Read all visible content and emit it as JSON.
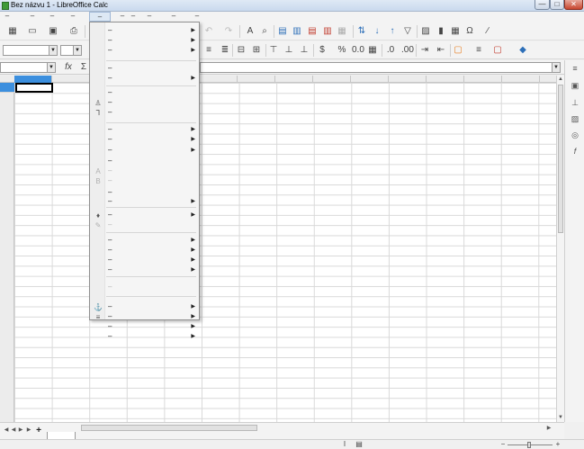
{
  "window": {
    "title": "Bez názvu 1 - LibreOffice Calc",
    "min_label": "—",
    "max_label": "□",
    "close_label": "✕"
  },
  "menubar": {
    "items": [
      {
        "label": "–"
      },
      {
        "label": "–"
      },
      {
        "label": "–"
      },
      {
        "label": "–"
      },
      {
        "label": "–"
      },
      {
        "label": "–"
      },
      {
        "label": "–"
      },
      {
        "label": "–"
      },
      {
        "label": "–"
      },
      {
        "label": "–"
      }
    ]
  },
  "toolbar1": {
    "icons": [
      "new-icon",
      "open-icon",
      "save-icon",
      "export-pdf-icon",
      "undo-icon",
      "redo-icon",
      "find-icon",
      "find-replace-icon",
      "spellcheck-icon",
      "row-icon",
      "column-icon",
      "insert-rows-icon",
      "insert-cols-icon",
      "sort-icon",
      "sort-ascending-icon",
      "sort-descending-icon",
      "autofilter-icon",
      "image-icon",
      "chart-icon",
      "pivot-icon",
      "special-char-icon",
      "link-icon"
    ]
  },
  "toolbar2": {
    "font_name": "",
    "font_size": "",
    "icons": [
      "align-left-icon",
      "merge-icon",
      "align-top-icon",
      "align-center-icon",
      "align-bottom-icon",
      "currency-icon",
      "percent-icon",
      "number-icon",
      "date-icon",
      "decimal-add-icon",
      "decimal-remove-icon",
      "indent-increase-icon",
      "indent-decrease-icon",
      "border-icon",
      "border-style-icon",
      "border-color-icon",
      "bg-color-icon"
    ]
  },
  "formulabar": {
    "cell_reference": "",
    "function_glyph": "fx",
    "sum_glyph": "Σ"
  },
  "sidebar": {
    "icons": [
      "properties-icon",
      "styles-icon",
      "gallery-icon",
      "navigator-icon",
      "functions-icon",
      "settings-icon"
    ]
  },
  "statusbar": {
    "zoom_minus": "−",
    "zoom_plus": "+"
  },
  "sheet": {
    "add_sheet_glyph": "+",
    "tab_label": ""
  },
  "dropdown_menu": {
    "items": [
      {
        "label": "–",
        "icon": "",
        "submenu": true,
        "disabled": false
      },
      {
        "label": "–",
        "icon": "",
        "submenu": true,
        "disabled": false
      },
      {
        "label": "–",
        "icon": "",
        "submenu": true,
        "disabled": false
      },
      {
        "label": "–",
        "icon": "",
        "submenu": false,
        "disabled": false
      },
      {
        "label": "–",
        "icon": "",
        "submenu": true,
        "disabled": false
      },
      {
        "label": "–",
        "icon": "",
        "submenu": false,
        "disabled": false
      },
      {
        "label": "–",
        "icon": "brush-icon",
        "submenu": false,
        "disabled": false
      },
      {
        "label": "–",
        "icon": "clear-format-icon",
        "submenu": false,
        "disabled": false
      },
      {
        "label": "–",
        "icon": "",
        "submenu": true,
        "disabled": false
      },
      {
        "label": "–",
        "icon": "",
        "submenu": true,
        "disabled": false
      },
      {
        "label": "–",
        "icon": "",
        "submenu": true,
        "disabled": false
      },
      {
        "label": "–",
        "icon": "",
        "submenu": false,
        "disabled": false
      },
      {
        "label": "–",
        "icon": "a-icon",
        "submenu": false,
        "disabled": true
      },
      {
        "label": "–",
        "icon": "b-icon",
        "submenu": false,
        "disabled": true
      },
      {
        "label": "–",
        "icon": "",
        "submenu": false,
        "disabled": false
      },
      {
        "label": "–",
        "icon": "",
        "submenu": true,
        "disabled": false
      },
      {
        "label": "–",
        "icon": "palette-icon",
        "submenu": true,
        "disabled": false
      },
      {
        "label": "–",
        "icon": "pencil-icon",
        "submenu": false,
        "disabled": true
      },
      {
        "label": "–",
        "icon": "",
        "submenu": true,
        "disabled": false
      },
      {
        "label": "–",
        "icon": "",
        "submenu": true,
        "disabled": false
      },
      {
        "label": "–",
        "icon": "",
        "submenu": true,
        "disabled": false
      },
      {
        "label": "–",
        "icon": "",
        "submenu": true,
        "disabled": false
      },
      {
        "label": "–",
        "icon": "",
        "submenu": false,
        "disabled": true
      },
      {
        "label": "–",
        "icon": "anchor-icon",
        "submenu": true,
        "disabled": false
      },
      {
        "label": "–",
        "icon": "wrap-icon",
        "submenu": true,
        "disabled": false
      },
      {
        "label": "–",
        "icon": "",
        "submenu": true,
        "disabled": false
      },
      {
        "label": "–",
        "icon": "",
        "submenu": true,
        "disabled": false
      }
    ]
  }
}
